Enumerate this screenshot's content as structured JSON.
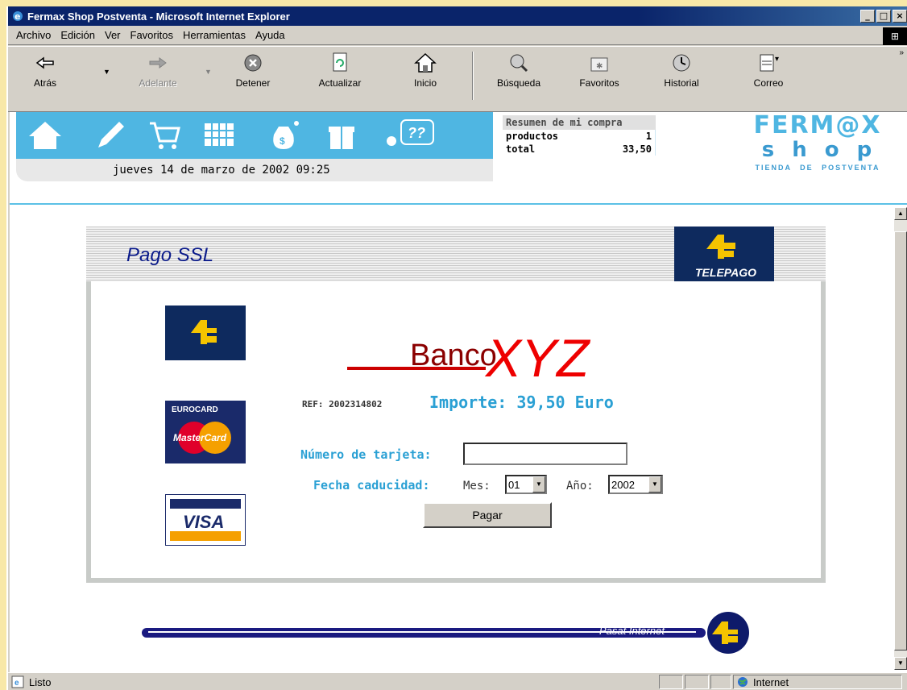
{
  "window": {
    "title": "Fermax Shop Postventa - Microsoft Internet Explorer"
  },
  "menu": [
    "Archivo",
    "Edición",
    "Ver",
    "Favoritos",
    "Herramientas",
    "Ayuda"
  ],
  "toolbar": {
    "back": "Atrás",
    "forward": "Adelante",
    "stop": "Detener",
    "refresh": "Actualizar",
    "home": "Inicio",
    "search": "Búsqueda",
    "favorites": "Favoritos",
    "history": "Historial",
    "mail": "Correo"
  },
  "shop": {
    "date": "jueves 14 de marzo de 2002   09:25",
    "summary_title": "Resumen de mi compra",
    "products_label": "productos",
    "products_value": "1",
    "total_label": "total",
    "total_value": "33,50",
    "brand_line1": "FERM@X",
    "brand_line2": "shop",
    "brand_line3": "TIENDA DE POSTVENTA"
  },
  "payment": {
    "title": "Pago SSL",
    "telepago_label": "TELEPAGO",
    "bank_name_1": "Banco",
    "bank_name_2": "XYZ",
    "ref": "REF: 2002314802",
    "amount": "Importe: 39,50 Euro",
    "card_number_label": "Número de tarjeta:",
    "card_number_value": "",
    "expiry_label": "Fecha caducidad:",
    "month_label": "Mes:",
    "month_value": "01",
    "year_label": "Año:",
    "year_value": "2002",
    "pay_button": "Pagar",
    "eurocard_text": "EUROCARD",
    "mastercard_text": "MasterCard",
    "visa_text": "VISA"
  },
  "footer": {
    "text": "Pasat Internet"
  },
  "status": {
    "text": "Listo",
    "zone": "Internet"
  }
}
